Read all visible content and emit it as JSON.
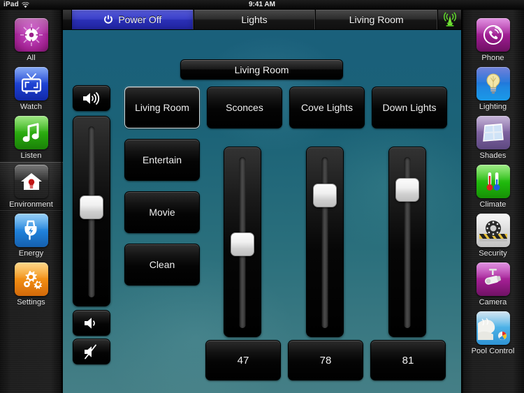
{
  "statusbar": {
    "device": "iPad",
    "wifi_icon": "wifi-icon",
    "time": "9:41 AM"
  },
  "navbar": {
    "power_icon": "power-icon",
    "buttons": [
      {
        "label": "Power Off",
        "active": true
      },
      {
        "label": "Lights",
        "active": false
      },
      {
        "label": "Living Room",
        "active": false
      }
    ],
    "signal_icon": "antenna-icon"
  },
  "left_sidebar": {
    "items": [
      {
        "label": "All",
        "icon": "compass-icon",
        "selected": false
      },
      {
        "label": "Watch",
        "icon": "television-icon",
        "selected": false
      },
      {
        "label": "Listen",
        "icon": "music-note-icon",
        "selected": false
      },
      {
        "label": "Environment",
        "icon": "house-bulb-icon",
        "selected": true
      },
      {
        "label": "Energy",
        "icon": "power-plug-icon",
        "selected": false
      },
      {
        "label": "Settings",
        "icon": "gears-icon",
        "selected": false
      }
    ]
  },
  "right_sidebar": {
    "items": [
      {
        "label": "Phone",
        "icon": "phone-icon",
        "selected": false
      },
      {
        "label": "Lighting",
        "icon": "lightbulb-icon",
        "selected": false
      },
      {
        "label": "Shades",
        "icon": "window-shades-icon",
        "selected": false
      },
      {
        "label": "Climate",
        "icon": "thermometer-icon",
        "selected": false
      },
      {
        "label": "Security",
        "icon": "alarm-siren-icon",
        "selected": false
      },
      {
        "label": "Camera",
        "icon": "security-camera-icon",
        "selected": false
      },
      {
        "label": "Pool Control",
        "icon": "pool-icon",
        "selected": false
      }
    ]
  },
  "main": {
    "room_title": "Living Room",
    "zone_buttons": [
      {
        "label": "Living Room",
        "selected": true
      },
      {
        "label": "Sconces",
        "selected": false
      },
      {
        "label": "Cove Lights",
        "selected": false
      },
      {
        "label": "Down Lights",
        "selected": false
      }
    ],
    "scene_buttons": [
      {
        "label": "Entertain"
      },
      {
        "label": "Movie"
      },
      {
        "label": "Clean"
      }
    ],
    "volume": {
      "up_icon": "volume-up-icon",
      "down_icon": "volume-down-icon",
      "mute_icon": "volume-mute-icon",
      "level": 55
    },
    "light_sliders": [
      {
        "name": "Sconces",
        "value": 47,
        "display": "47"
      },
      {
        "name": "Cove Lights",
        "value": 78,
        "display": "78"
      },
      {
        "name": "Down Lights",
        "value": 81,
        "display": "81"
      }
    ]
  },
  "colors": {
    "accent_blue": "#3a3fc8",
    "stage_top": "#1a5f7c",
    "stage_bottom": "#457f86",
    "rail_dark": "#1e1e1e",
    "button_black": "#000000",
    "text_light": "#f0f0f0"
  }
}
